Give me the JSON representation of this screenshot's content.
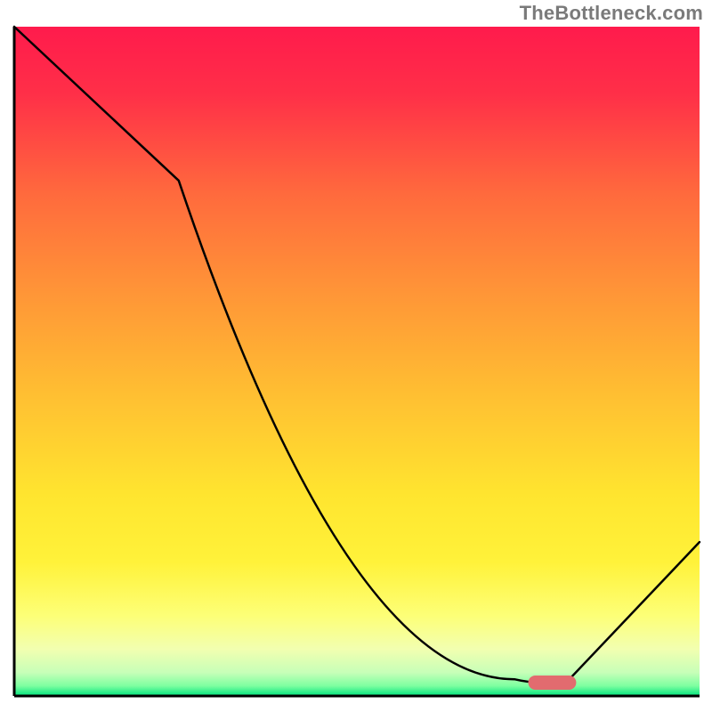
{
  "attribution": "TheBottleneck.com",
  "chart_data": {
    "type": "line",
    "title": "",
    "xlabel": "",
    "ylabel": "",
    "xlim": [
      0,
      100
    ],
    "ylim": [
      0,
      100
    ],
    "x": [
      0,
      24,
      73,
      77,
      81,
      100
    ],
    "values": [
      100,
      77,
      2.5,
      2,
      2.5,
      23
    ],
    "marker": {
      "x_range": [
        75,
        82
      ],
      "y": 2
    },
    "gradient_stops": [
      {
        "pos": 0.0,
        "color": "#ff1b4c"
      },
      {
        "pos": 0.1,
        "color": "#ff2f48"
      },
      {
        "pos": 0.25,
        "color": "#ff6a3d"
      },
      {
        "pos": 0.4,
        "color": "#ff9637"
      },
      {
        "pos": 0.55,
        "color": "#ffbf32"
      },
      {
        "pos": 0.7,
        "color": "#ffe52f"
      },
      {
        "pos": 0.8,
        "color": "#fff23a"
      },
      {
        "pos": 0.88,
        "color": "#fdff77"
      },
      {
        "pos": 0.93,
        "color": "#f2ffb0"
      },
      {
        "pos": 0.965,
        "color": "#c7ffb8"
      },
      {
        "pos": 0.985,
        "color": "#7dffa0"
      },
      {
        "pos": 1.0,
        "color": "#00e37d"
      }
    ],
    "axis_color": "#000000"
  }
}
